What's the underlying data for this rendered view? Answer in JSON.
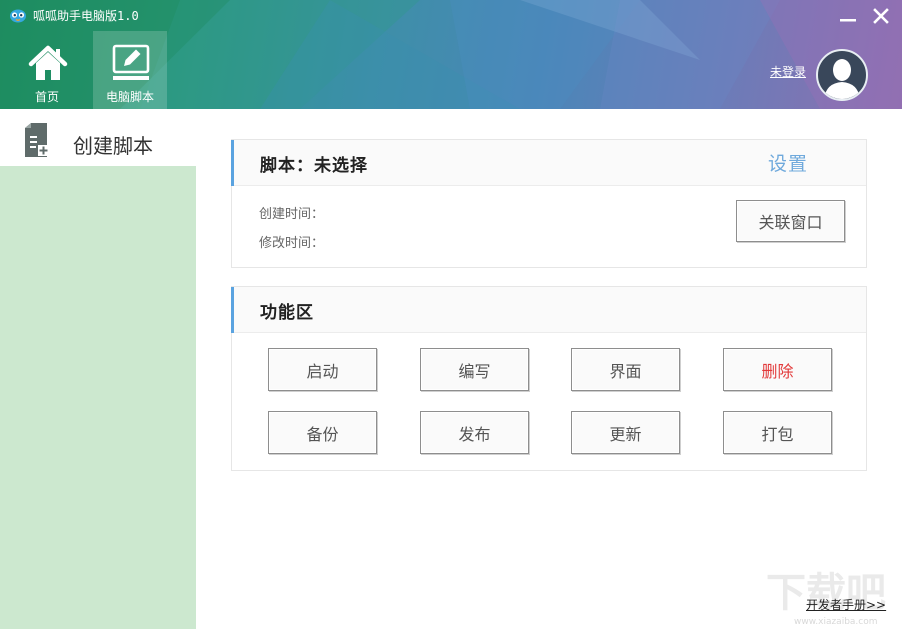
{
  "window": {
    "title": "呱呱助手电脑版1.0"
  },
  "nav": [
    {
      "label": "首页",
      "icon": "home-icon"
    },
    {
      "label": "电脑脚本",
      "icon": "edit-board-icon"
    }
  ],
  "user": {
    "login_label": "未登录"
  },
  "sidebar": {
    "items": [
      {
        "label": "创建脚本",
        "icon": "new-script-icon"
      }
    ]
  },
  "script_panel": {
    "title": "脚本：未选择",
    "settings_label": "设置",
    "created_label": "创建时间：",
    "modified_label": "修改时间：",
    "link_window_label": "关联窗口"
  },
  "func_panel": {
    "title": "功能区",
    "buttons": [
      "启动",
      "编写",
      "界面",
      "删除",
      "备份",
      "发布",
      "更新",
      "打包"
    ]
  },
  "footer": {
    "dev_manual_label": "开发者手册>>",
    "watermark_text": "下载吧",
    "watermark_url": "www.xiazaiba.com"
  },
  "colors": {
    "accent": "#5aa3e0",
    "sidebar_bg": "#cce8cf",
    "danger": "#e2393a"
  }
}
